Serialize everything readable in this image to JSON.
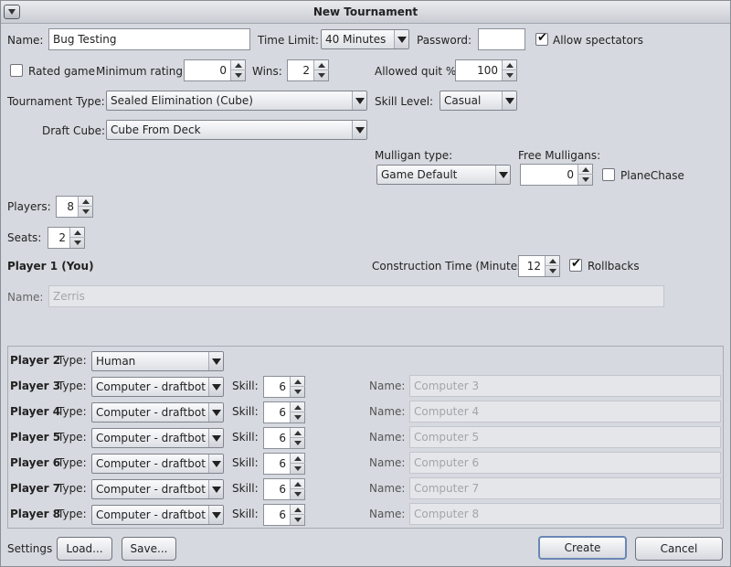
{
  "window": {
    "title": "New Tournament"
  },
  "name": {
    "label": "Name:",
    "value": "Bug Testing"
  },
  "time_limit": {
    "label": "Time Limit:",
    "value": "40 Minutes"
  },
  "password": {
    "label": "Password:",
    "value": ""
  },
  "allow_spectators": {
    "label": "Allow spectators",
    "checked": true
  },
  "rated_game": {
    "label": "Rated game",
    "checked": false
  },
  "minimum_rating": {
    "label": "Minimum rating:",
    "value": "0"
  },
  "wins": {
    "label": "Wins:",
    "value": "2"
  },
  "allowed_quit": {
    "label": "Allowed quit %",
    "value": "100"
  },
  "tournament_type": {
    "label": "Tournament Type:",
    "value": "Sealed Elimination (Cube)"
  },
  "skill_level": {
    "label": "Skill Level:",
    "value": "Casual"
  },
  "draft_cube": {
    "label": "Draft Cube:",
    "value": "Cube From Deck"
  },
  "mulligan_type": {
    "label": "Mulligan type:",
    "value": "Game Default"
  },
  "free_mulligans": {
    "label": "Free Mulligans:",
    "value": "0"
  },
  "planechase": {
    "label": "PlaneChase",
    "checked": false
  },
  "players": {
    "label": "Players:",
    "value": "8"
  },
  "seats": {
    "label": "Seats:",
    "value": "2"
  },
  "player1": {
    "heading": "Player 1 (You)",
    "name_label": "Name:",
    "name_value": "Zerris"
  },
  "construction_time": {
    "label": "Construction Time (Minutes):",
    "value": "12"
  },
  "rollbacks": {
    "label": "Rollbacks",
    "checked": true
  },
  "players_table": {
    "type_label": "Type:",
    "skill_label": "Skill:",
    "name_label": "Name:",
    "rows": [
      {
        "player": "Player 2",
        "type": "Human"
      },
      {
        "player": "Player 3",
        "type": "Computer - draftbot",
        "skill": "6",
        "name": "Computer 3"
      },
      {
        "player": "Player 4",
        "type": "Computer - draftbot",
        "skill": "6",
        "name": "Computer 4"
      },
      {
        "player": "Player 5",
        "type": "Computer - draftbot",
        "skill": "6",
        "name": "Computer 5"
      },
      {
        "player": "Player 6",
        "type": "Computer - draftbot",
        "skill": "6",
        "name": "Computer 6"
      },
      {
        "player": "Player 7",
        "type": "Computer - draftbot",
        "skill": "6",
        "name": "Computer 7"
      },
      {
        "player": "Player 8",
        "type": "Computer - draftbot",
        "skill": "6",
        "name": "Computer 8"
      }
    ]
  },
  "footer": {
    "settings_label": "Settings",
    "load_label": "Load...",
    "save_label": "Save...",
    "create_label": "Create",
    "cancel_label": "Cancel"
  }
}
